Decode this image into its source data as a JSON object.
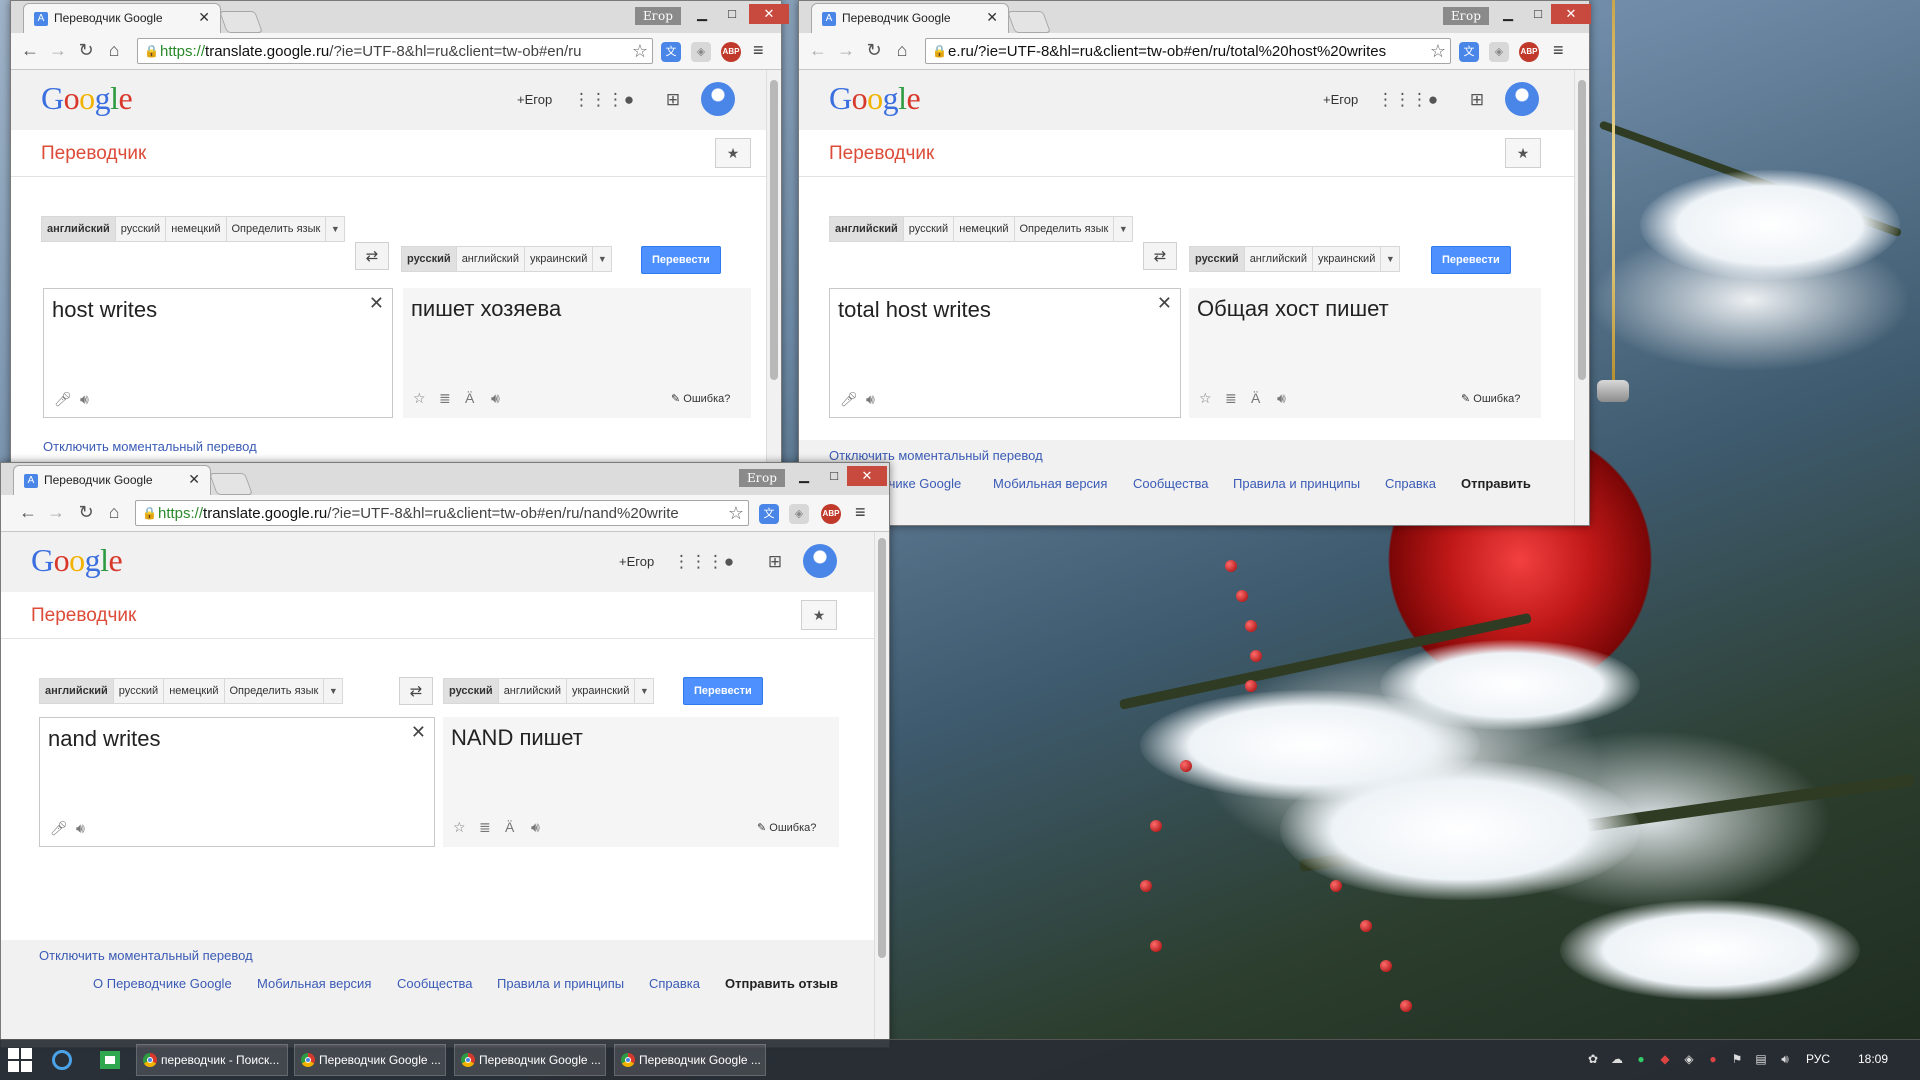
{
  "colors": {
    "google_red": "#dd4b39",
    "translate_blue": "#4d90fe",
    "link_blue": "#3b5bb5"
  },
  "windows": [
    {
      "tab_title": "Переводчик Google",
      "profile": "Егор",
      "url_proto": "https://",
      "url_host": "translate.google.ru",
      "url_rest": "/?ie=UTF-8&hl=ru&client=tw-ob#en/ru",
      "plus_user": "+Егор",
      "page_title": "Переводчик",
      "src_langs": [
        "английский",
        "русский",
        "немецкий",
        "Определить язык"
      ],
      "tgt_langs": [
        "русский",
        "английский",
        "украинский"
      ],
      "translate_button": "Перевести",
      "source_text": "host writes",
      "target_text": "пишет хозяева",
      "error_link": "Ошибка?",
      "instant_link": "Отключить моментальный перевод"
    },
    {
      "tab_title": "Переводчик Google",
      "profile": "Егор",
      "url_text": "e.ru/?ie=UTF-8&hl=ru&client=tw-ob#en/ru/total%20host%20writes",
      "plus_user": "+Егор",
      "page_title": "Переводчик",
      "src_langs": [
        "английский",
        "русский",
        "немецкий",
        "Определить язык"
      ],
      "tgt_langs": [
        "русский",
        "английский",
        "украинский"
      ],
      "translate_button": "Перевести",
      "source_text": "total host writes",
      "target_text": "Общая хост пишет",
      "error_link": "Ошибка?",
      "instant_link": "Отключить моментальный перевод",
      "footer": [
        "дчике Google",
        "Мобильная версия",
        "Сообщества",
        "Правила и принципы",
        "Справка"
      ],
      "footer_send": "Отправить"
    },
    {
      "tab_title": "Переводчик Google",
      "profile": "Егор",
      "url_proto": "https://",
      "url_host": "translate.google.ru",
      "url_rest": "/?ie=UTF-8&hl=ru&client=tw-ob#en/ru/nand%20write",
      "plus_user": "+Егор",
      "page_title": "Переводчик",
      "src_langs": [
        "английский",
        "русский",
        "немецкий",
        "Определить язык"
      ],
      "tgt_langs": [
        "русский",
        "английский",
        "украинский"
      ],
      "translate_button": "Перевести",
      "source_text": "nand writes",
      "target_text": "NAND пишет",
      "error_link": "Ошибка?",
      "instant_link": "Отключить моментальный перевод",
      "footer": [
        "О Переводчике Google",
        "Мобильная версия",
        "Сообщества",
        "Правила и принципы",
        "Справка"
      ],
      "footer_send": "Отправить отзыв"
    }
  ],
  "taskbar": {
    "items": [
      "переводчик - Поиск...",
      "Переводчик Google ...",
      "Переводчик Google ...",
      "Переводчик Google ..."
    ],
    "language": "РУС",
    "clock": "18:09"
  }
}
